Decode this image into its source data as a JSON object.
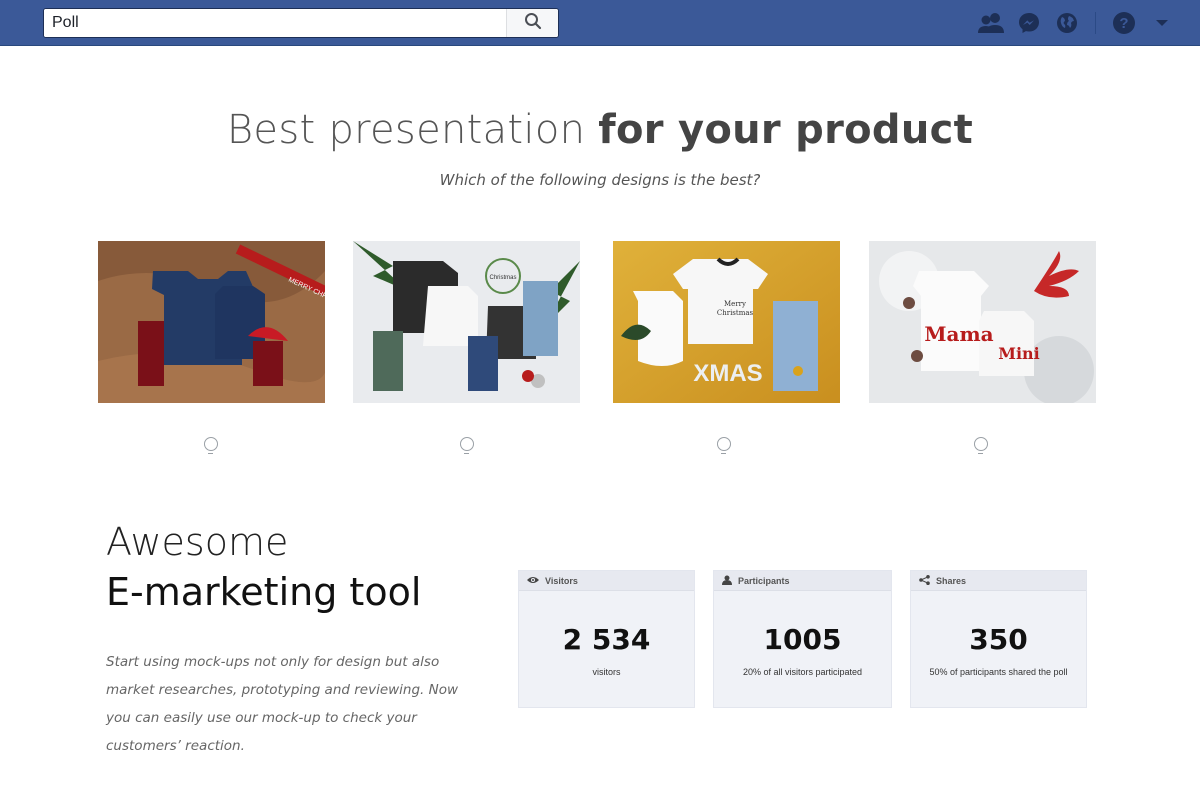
{
  "header": {
    "search_value": "Poll",
    "search_icon": "search-icon",
    "icons": [
      "friends-icon",
      "messenger-icon",
      "globe-icon",
      "help-icon",
      "caret-down-icon"
    ]
  },
  "hero": {
    "title_light": "Best presentation ",
    "title_bold": "for your product",
    "subtitle": "Which of the following designs is the best?"
  },
  "poll": {
    "options": [
      {
        "image": "christmas-tshirts-on-wood",
        "card_text_1": "MERRY CHRISTMAS"
      },
      {
        "image": "christmas-family-tshirts-with-jeans",
        "card_text_1": "Christmas"
      },
      {
        "image": "merry-christmas-baby-tshirts-on-gold",
        "card_text_1": "XMAS"
      },
      {
        "image": "mama-mini-tshirts-on-snow",
        "card_text_1": "Mama",
        "card_text_2": "Mini"
      }
    ]
  },
  "promo": {
    "title_line1": "Awesome",
    "title_line2": "E-marketing tool",
    "text": "Start using mock-ups not only for design but also market researches, prototyping and reviewing. Now you can easily use our mock-up to check your customers’ reaction."
  },
  "stats": [
    {
      "label": "Visitors",
      "icon": "eye-icon",
      "value": "2 534",
      "note": "visitors"
    },
    {
      "label": "Participants",
      "icon": "person-icon",
      "value": "1005",
      "note": "20% of all visitors participated"
    },
    {
      "label": "Shares",
      "icon": "share-icon",
      "value": "350",
      "note": "50% of participants shared the poll"
    }
  ],
  "colors": {
    "topbar": "#3b5998",
    "stat_bg": "#f0f2f7"
  }
}
